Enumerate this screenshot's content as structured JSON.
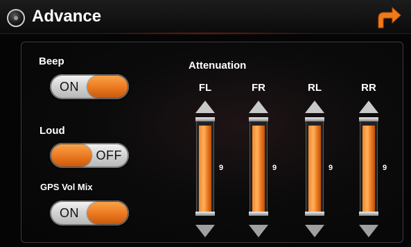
{
  "header": {
    "title": "Advance",
    "title_icon": "disc-icon",
    "back_icon": "return-arrow-icon"
  },
  "options": {
    "beep": {
      "label": "Beep",
      "state": "ON"
    },
    "loud": {
      "label": "Loud",
      "state": "OFF"
    },
    "gps_vol_mix": {
      "label": "GPS Vol Mix",
      "state": "ON"
    }
  },
  "attenuation": {
    "title": "Attenuation",
    "channels": [
      {
        "label": "FL",
        "value": "9",
        "level": 0.95
      },
      {
        "label": "FR",
        "value": "9",
        "level": 0.95
      },
      {
        "label": "RL",
        "value": "9",
        "level": 0.95
      },
      {
        "label": "RR",
        "value": "9",
        "level": 0.95
      }
    ]
  },
  "colors": {
    "accent": "#ea7820",
    "background": "#050505",
    "toggle_track": "#d2d2d2"
  }
}
